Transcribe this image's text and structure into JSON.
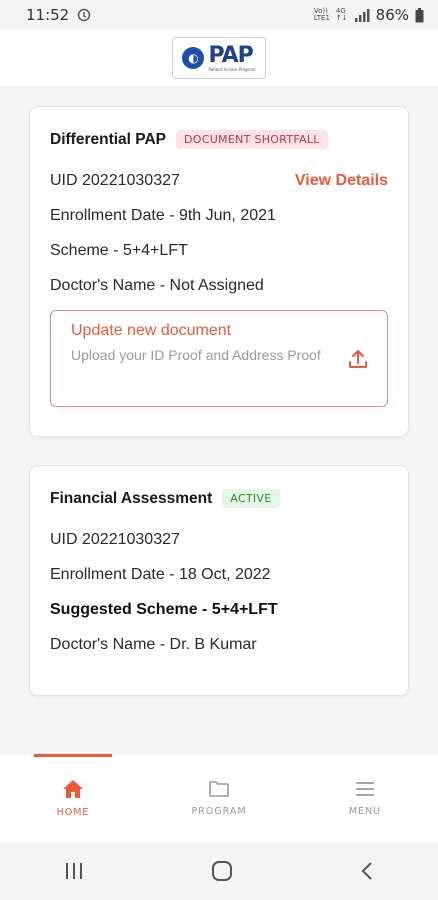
{
  "status_bar": {
    "time": "11:52",
    "network_top": "Vo))",
    "network_bottom": "LTE1",
    "net_4g": "4G",
    "battery": "86%"
  },
  "header": {
    "logo_text": "PAP",
    "logo_tagline": "Patient Access Program"
  },
  "cards": [
    {
      "title": "Differential PAP",
      "badge": "DOCUMENT SHORTFALL",
      "uid": "UID 20221030327",
      "view_details": "View Details",
      "enrollment": "Enrollment Date - 9th Jun, 2021",
      "scheme": "Scheme - 5+4+LFT",
      "doctor": "Doctor's Name - Not Assigned",
      "update_title": "Update new document",
      "update_subtitle": "Upload your ID Proof and Address Proof"
    },
    {
      "title": "Financial Assessment",
      "badge": "ACTIVE",
      "uid": "UID 20221030327",
      "enrollment": "Enrollment Date - 18 Oct, 2022",
      "scheme": "Suggested Scheme - 5+4+LFT",
      "doctor": "Doctor's Name - Dr. B Kumar"
    }
  ],
  "bottom_nav": [
    {
      "label": "HOME",
      "icon": "home-icon",
      "active": true
    },
    {
      "label": "PROGRAM",
      "icon": "folder-icon",
      "active": false
    },
    {
      "label": "MENU",
      "icon": "menu-icon",
      "active": false
    }
  ],
  "colors": {
    "accent": "#ea5a3c",
    "shortfall_bg": "#fde3e6",
    "active_bg": "#e4f6e4"
  }
}
